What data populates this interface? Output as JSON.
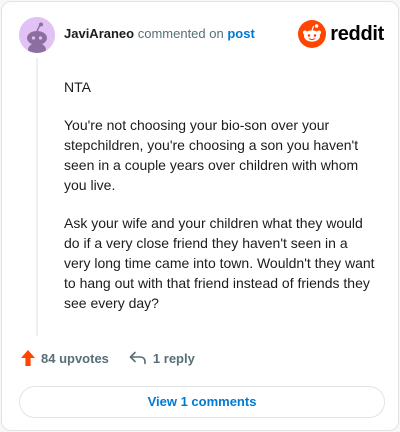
{
  "header": {
    "username": "JaviAraneo",
    "action_text": "commented on",
    "post_link": "post"
  },
  "brand": {
    "name": "reddit",
    "color": "#ff4500"
  },
  "comment": {
    "paragraphs": [
      "NTA",
      "You're not choosing your bio-son over your stepchildren, you're choosing a son you haven't seen in a couple years over children with whom you live.",
      "Ask your wife and your children what they would do if a very close friend they haven't seen in a very long time came into town. Wouldn't they want to hang out with that friend instead of friends they see every day?"
    ]
  },
  "actions": {
    "upvotes": "84 upvotes",
    "reply": "1 reply"
  },
  "view_button": "View 1 comments",
  "colors": {
    "accent": "#0079d3",
    "upvote": "#ff4500",
    "avatar_bg": "#e2c1f5"
  },
  "icons": {
    "avatar": "snoo-avatar",
    "logo": "reddit-snoo-icon",
    "upvote": "upvote-arrow-icon",
    "reply": "reply-arrow-icon"
  }
}
